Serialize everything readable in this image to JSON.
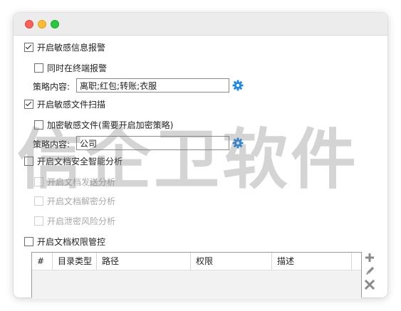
{
  "options": {
    "enable_sensitive_alert": {
      "label": "开启敏感信息报警",
      "checked": true
    },
    "also_alert_terminal": {
      "label": "同时在终端报警",
      "checked": false
    },
    "strategy_content_label_1": "策略内容:",
    "strategy_content_value_1": "离职;红包;转账;衣服",
    "enable_sensitive_file_scan": {
      "label": "开启敏感文件扫描",
      "checked": true
    },
    "encrypt_sensitive_file": {
      "label": "加密敏感文件(需要开启加密策略)",
      "checked": false
    },
    "strategy_content_label_2": "策略内容:",
    "strategy_content_value_2": "公司",
    "enable_doc_security_analysis": {
      "label": "开启文档安全智能分析",
      "checked": false
    },
    "doc_send_analysis": {
      "label": "开启文档发送分析",
      "checked": false,
      "disabled": true
    },
    "doc_decrypt_analysis": {
      "label": "开启文档解密分析",
      "checked": false,
      "disabled": true
    },
    "leak_risk_analysis": {
      "label": "开启泄密风险分析",
      "checked": false,
      "disabled": true
    },
    "enable_doc_permission": {
      "label": "开启文档权限管控",
      "checked": false
    }
  },
  "table": {
    "columns": [
      "#",
      "目录类型",
      "路径",
      "权限",
      "描述"
    ]
  },
  "watermark": "信企卫软件",
  "icons": {
    "settings": "gear-icon",
    "add": "plus-icon",
    "edit": "pencil-icon",
    "delete": "x-icon"
  },
  "colors": {
    "accent_blue": "#1e88e5",
    "icon_gray": "#8a8a8a"
  }
}
